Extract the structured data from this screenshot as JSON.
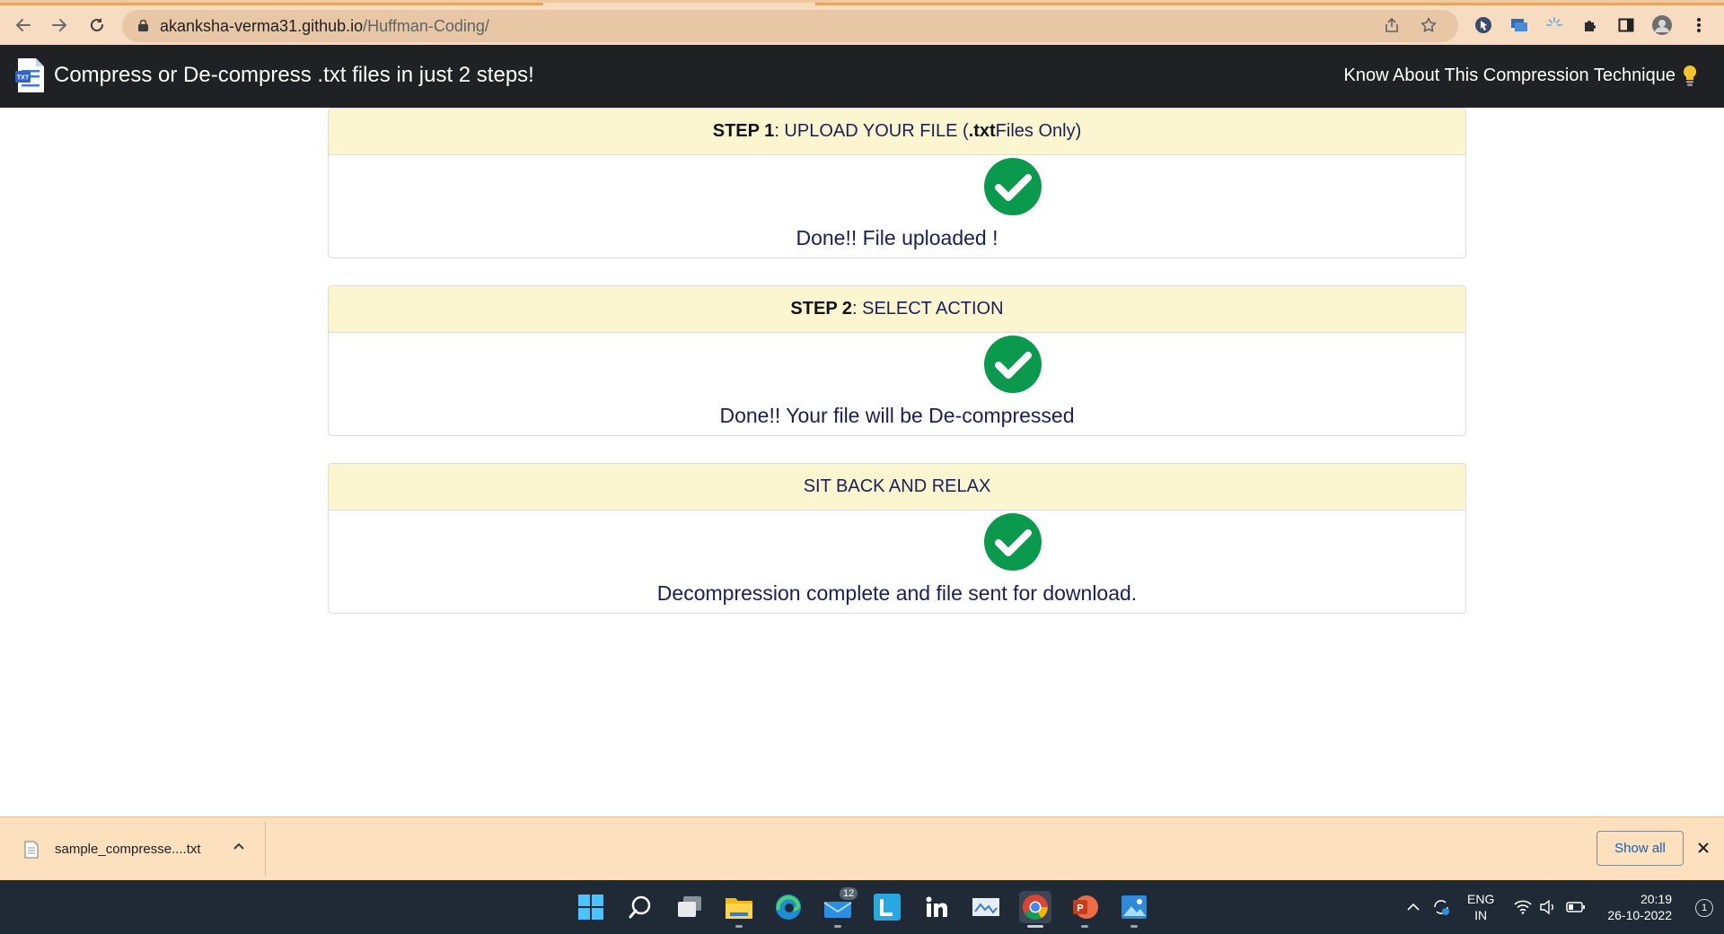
{
  "browser": {
    "url_domain": "akanksha-verma31.github.io",
    "url_path": "/Huffman-Coding/"
  },
  "navbar": {
    "title": "Compress or De-compress .txt files in just 2 steps!",
    "link": "Know About This Compression Technique"
  },
  "cards": [
    {
      "header_bold": "STEP 1",
      "header_text_before": ": UPLOAD YOUR FILE (",
      "header_bold_ext": ".txt",
      "header_text_after": " Files Only)",
      "message": "Done!! File uploaded !"
    },
    {
      "header_bold": "STEP 2",
      "header_text": ": SELECT ACTION",
      "message": "Done!! Your file will be De-compressed"
    },
    {
      "header_text": "SIT BACK AND RELAX",
      "message": "Decompression complete and file sent for download."
    }
  ],
  "download_bar": {
    "file_name": "sample_compresse....txt",
    "show_all": "Show all"
  },
  "taskbar": {
    "mail_badge": "12",
    "lang_line1": "ENG",
    "lang_line2": "IN",
    "time": "20:19",
    "date": "26-10-2022",
    "notification_count": "1"
  },
  "colors": {
    "success_green": "#0b9a4d",
    "navbar_bg": "#202124",
    "card_header_bg": "#fbf6cf",
    "card_text": "#1a1f5a",
    "download_bar_bg": "#fde0bd",
    "taskbar_bg": "#1f2a36"
  }
}
